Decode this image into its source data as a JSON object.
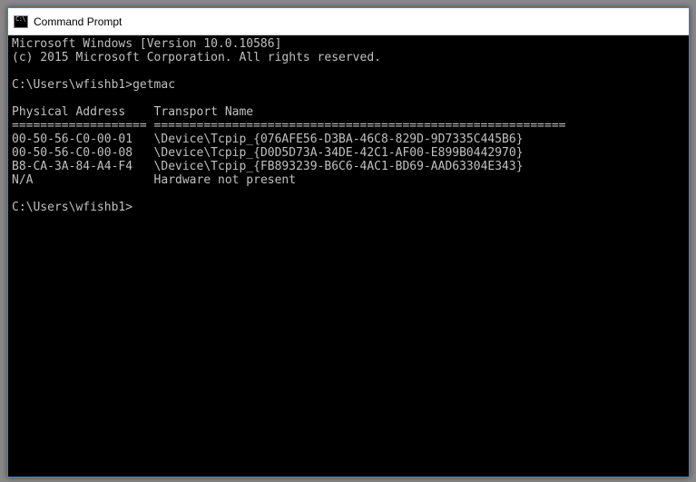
{
  "titlebar": {
    "title": "Command Prompt"
  },
  "terminal": {
    "line_version": "Microsoft Windows [Version 10.0.10586]",
    "line_copyright": "(c) 2015 Microsoft Corporation. All rights reserved.",
    "prompt1_path": "C:\\Users\\wfishb1>",
    "prompt1_command": "getmac",
    "header_physical": "Physical Address",
    "header_transport": "Transport Name",
    "separator": "=================== ==========================================================",
    "row1_addr": "00-50-56-C0-00-01",
    "row1_name": "\\Device\\Tcpip_{076AFE56-D3BA-46C8-829D-9D7335C445B6}",
    "row2_addr": "00-50-56-C0-00-08",
    "row2_name": "\\Device\\Tcpip_{D0D5D73A-34DE-42C1-AF00-E899B0442970}",
    "row3_addr": "B8-CA-3A-84-A4-F4",
    "row3_name": "\\Device\\Tcpip_{FB893239-B6C6-4AC1-BD69-AAD63304E343}",
    "row4_addr": "N/A",
    "row4_name": "Hardware not present",
    "prompt2_path": "C:\\Users\\wfishb1>"
  }
}
